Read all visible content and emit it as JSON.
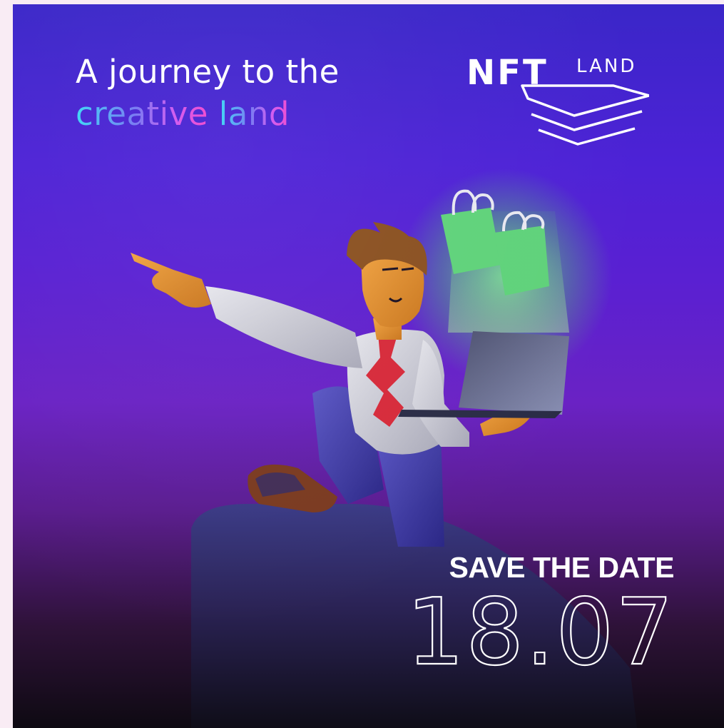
{
  "headline": {
    "line1": "A journey to the",
    "line2_part1": "creative",
    "line2_part2": "land"
  },
  "logo": {
    "nft": "NFT",
    "land": "LAND"
  },
  "event": {
    "save_the_date": "SAVE THE DATE",
    "date": "18.07"
  },
  "colors": {
    "background_top": "#3a26c8",
    "background_bottom": "#0e0a12",
    "accent_cyan": "#42d9f5",
    "accent_pink": "#f04ecf",
    "shopping_bag": "#5fd27a"
  },
  "illustration": {
    "subject": "man pointing while holding a laptop",
    "icons": [
      "shopping-bag-icon",
      "laptop-icon"
    ]
  }
}
